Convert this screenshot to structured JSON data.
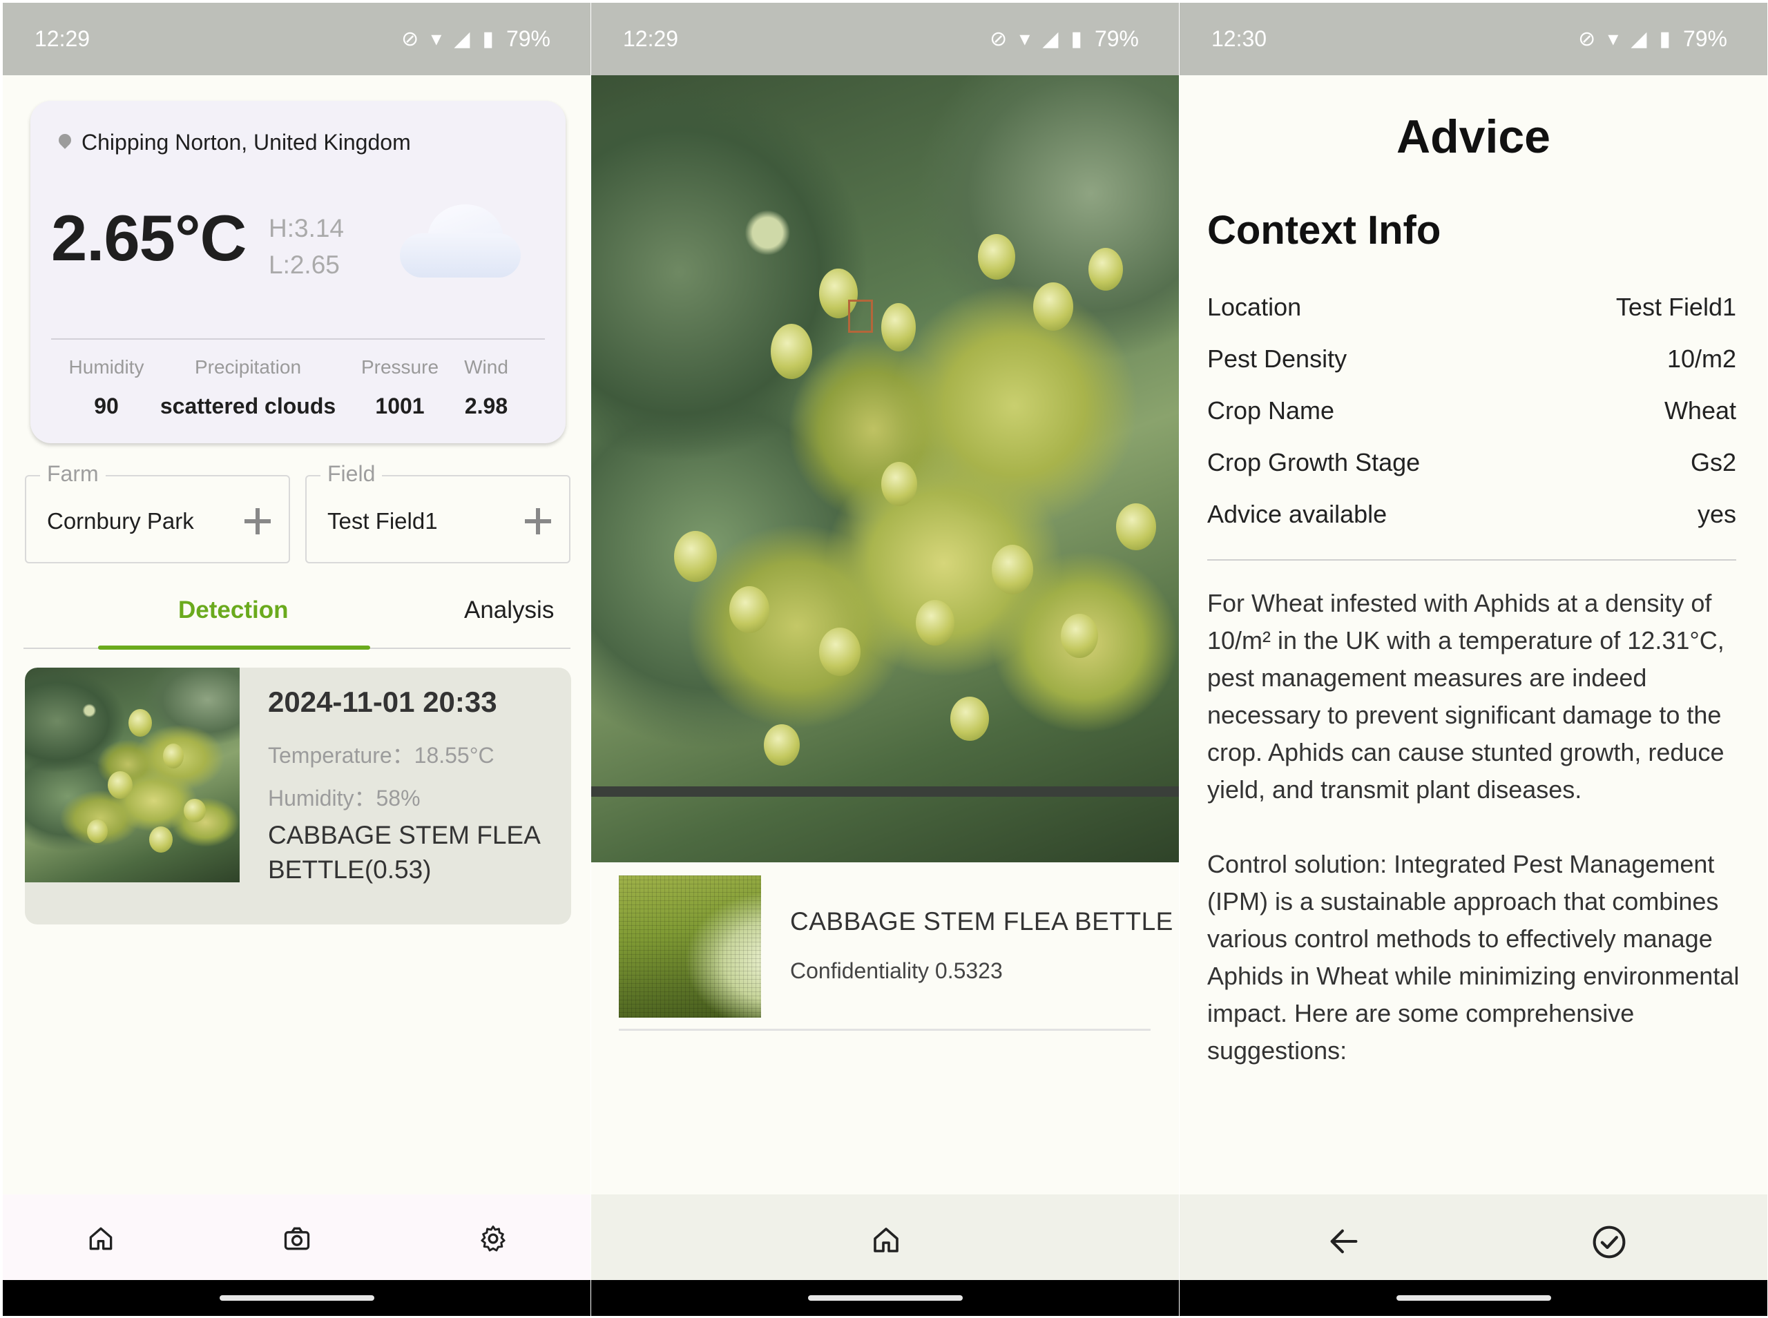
{
  "statusbar": [
    {
      "time": "12:29",
      "battery": "79%"
    },
    {
      "time": "12:29",
      "battery": "79%"
    },
    {
      "time": "12:30",
      "battery": "79%"
    }
  ],
  "home": {
    "location": "Chipping Norton, United Kingdom",
    "temperature": "2.65°C",
    "high": "H:3.14",
    "low": "L:2.65",
    "weather_icon": "cloud-icon",
    "stats": [
      {
        "label": "Humidity",
        "value": "90"
      },
      {
        "label": "Precipitation",
        "value": "scattered clouds"
      },
      {
        "label": "Pressure",
        "value": "1001"
      },
      {
        "label": "Wind",
        "value": "2.98"
      }
    ],
    "farm": {
      "label": "Farm",
      "value": "Cornbury Park"
    },
    "field": {
      "label": "Field",
      "value": "Test Field1"
    },
    "tabs": [
      {
        "label": "Detection",
        "active": true
      },
      {
        "label": "Analysis",
        "active": false
      }
    ],
    "detection": {
      "date": "2024-11-01 20:33",
      "temperature": "Temperature：18.55°C",
      "humidity": "Humidity：58%",
      "pest": "CABBAGE STEM FLEA BETTLE(0.53)"
    },
    "nav_icons": [
      "home-icon",
      "camera-icon",
      "settings-icon"
    ]
  },
  "result": {
    "pest_name": "CABBAGE STEM FLEA BETTLE",
    "confidence": "Confidentiality 0.5323",
    "nav_icons": [
      "home-icon"
    ]
  },
  "advice": {
    "title": "Advice",
    "context_title": "Context Info",
    "context": [
      {
        "key": "Location",
        "value": "Test Field1"
      },
      {
        "key": "Pest Density",
        "value": "10/m2"
      },
      {
        "key": "Crop Name",
        "value": "Wheat"
      },
      {
        "key": "Crop Growth Stage",
        "value": "Gs2"
      },
      {
        "key": "Advice available",
        "value": "yes"
      }
    ],
    "paragraphs": [
      "For Wheat infested with Aphids at a density of 10/m² in the UK with a temperature of 12.31°C, pest management measures are indeed necessary to prevent significant damage to the crop. Aphids can cause stunted growth, reduce yield, and transmit plant diseases.",
      "Control solution: Integrated Pest Management (IPM) is a sustainable approach that combines various control methods to effectively manage Aphids in Wheat while minimizing environmental impact. Here are some comprehensive suggestions:"
    ],
    "nav_icons": [
      "back-arrow-icon",
      "check-circle-icon"
    ]
  },
  "colors": {
    "accent": "#6aaa1d",
    "statusbar": "#bdbfb9",
    "background": "#fcfcf6"
  }
}
